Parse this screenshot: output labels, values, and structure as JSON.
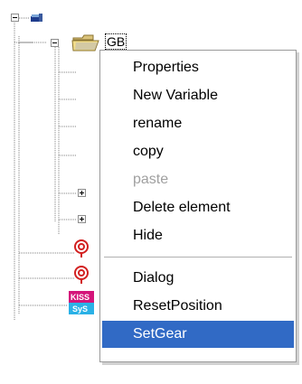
{
  "tree": {
    "selected_node_label": "GB",
    "icons": [
      "minus-expander-icon",
      "computer-icon",
      "folder-open-icon",
      "plus-expander-icon",
      "red-target-icon",
      "kiss-sys-icon"
    ]
  },
  "context_menu": {
    "items": [
      {
        "label": "Properties",
        "state": "normal"
      },
      {
        "label": "New Variable",
        "state": "normal"
      },
      {
        "label": "rename",
        "state": "normal"
      },
      {
        "label": "copy",
        "state": "normal"
      },
      {
        "label": "paste",
        "state": "disabled"
      },
      {
        "label": "Delete element",
        "state": "normal"
      },
      {
        "label": "Hide",
        "state": "normal"
      },
      {
        "label": "Dialog",
        "state": "normal"
      },
      {
        "label": "ResetPosition",
        "state": "normal"
      },
      {
        "label": "SetGear",
        "state": "highlighted"
      }
    ]
  },
  "colors": {
    "highlight": "#316ac5",
    "disabled_text": "#a0a0a0",
    "tree_line": "#808080"
  }
}
